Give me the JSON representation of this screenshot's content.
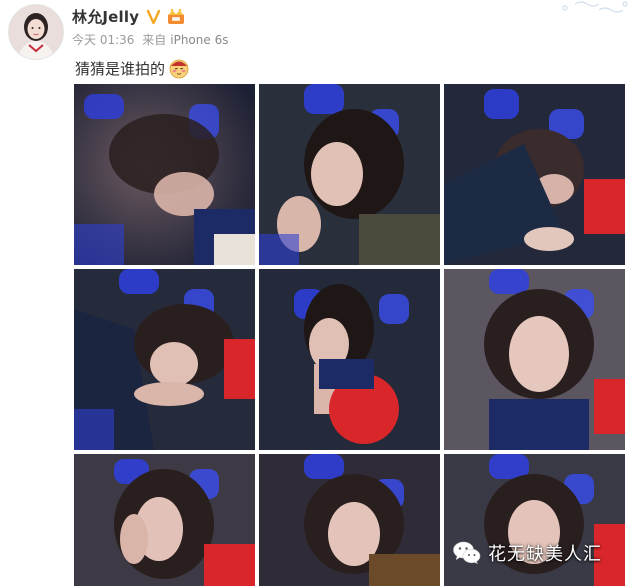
{
  "post": {
    "author": "林允Jelly",
    "time": "今天 01:36",
    "source_prefix": "来自",
    "device": "iPhone 6s",
    "text": "猜猜是谁拍的"
  },
  "badges": {
    "verified": "verified-v-badge",
    "vip": "vip-crown-badge"
  },
  "photos": [
    {
      "id": "photo-1",
      "alt": "selfie 1"
    },
    {
      "id": "photo-2",
      "alt": "selfie 2"
    },
    {
      "id": "photo-3",
      "alt": "selfie 3"
    },
    {
      "id": "photo-4",
      "alt": "selfie 4"
    },
    {
      "id": "photo-5",
      "alt": "selfie 5"
    },
    {
      "id": "photo-6",
      "alt": "selfie 6"
    },
    {
      "id": "photo-7",
      "alt": "selfie 7"
    },
    {
      "id": "photo-8",
      "alt": "selfie 8"
    },
    {
      "id": "photo-9",
      "alt": "selfie 9"
    }
  ],
  "watermark": {
    "icon": "wechat-icon",
    "text": "花无缺美人汇"
  },
  "colors": {
    "username": "#333333",
    "meta": "#9a9a9a",
    "verified": "#f5a623",
    "photo_blue": "#2f3fe0",
    "photo_red": "#d8262b"
  }
}
